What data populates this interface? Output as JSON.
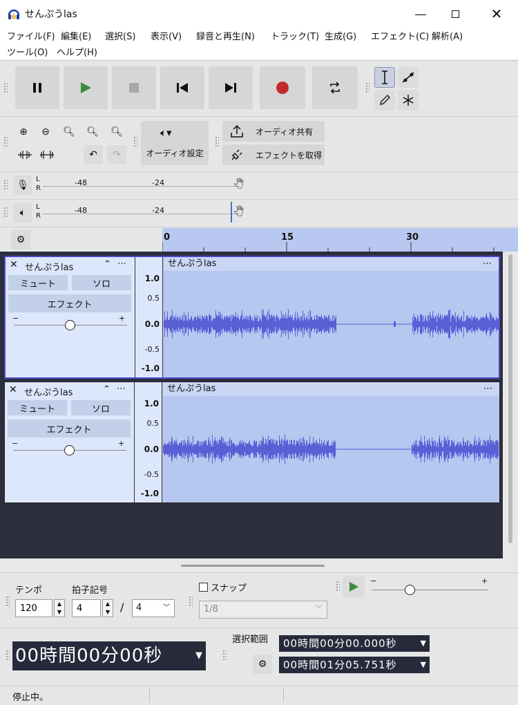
{
  "window": {
    "title": "せんぷうlas"
  },
  "menu": [
    "ファイル(F)",
    "編集(E)",
    "選択(S)",
    "表示(V)",
    "録音と再生(N)",
    "トラック(T)",
    "生成(G)",
    "エフェクト(C)",
    "解析(A)",
    "ツール(O)",
    "ヘルプ(H)"
  ],
  "toolbar": {
    "share_label": "オーディオ共有",
    "get_effects_label": "エフェクトを取得",
    "audio_setup_label": "オーディオ設定"
  },
  "meters": {
    "channel_l": "L",
    "channel_r": "R",
    "tick_48": "-48",
    "tick_24": "-24"
  },
  "ruler": {
    "ticks": [
      "0",
      "15",
      "30"
    ]
  },
  "tracks": [
    {
      "name": "せんぷうlas",
      "clip_name": "せんぷうlas",
      "mute": "ミュート",
      "solo": "ソロ",
      "effects": "エフェクト",
      "scale": [
        "1.0",
        "0.5",
        "0.0",
        "-0.5",
        "-1.0"
      ],
      "pan_minus": "−",
      "pan_plus": "+"
    },
    {
      "name": "せんぷうlas",
      "clip_name": "せんぷうlas",
      "mute": "ミュート",
      "solo": "ソロ",
      "effects": "エフェクト",
      "scale": [
        "1.0",
        "0.5",
        "0.0",
        "-0.5",
        "-1.0"
      ],
      "pan_minus": "−",
      "pan_plus": "+"
    }
  ],
  "bottom": {
    "tempo_label": "テンポ",
    "tempo_value": "120",
    "time_sig_label": "拍子記号",
    "time_sig_num": "4",
    "time_sig_sep": "/",
    "time_sig_den": "4",
    "snap_label": "スナップ",
    "snap_value": "1/8",
    "time_display": "00時間00分00秒",
    "selection_label": "選択範囲",
    "sel_start": "00時間00分00.000秒",
    "sel_end": "00時間01分05.751秒",
    "speed_minus": "−",
    "speed_plus": "+"
  },
  "status": {
    "text": "停止中。"
  },
  "colors": {
    "record": "#c42b2b",
    "play": "#3c8a3c",
    "waveform": "#5b5fd6",
    "clip_bg": "#b6c7f0",
    "selected_border": "#4a4ac8"
  }
}
